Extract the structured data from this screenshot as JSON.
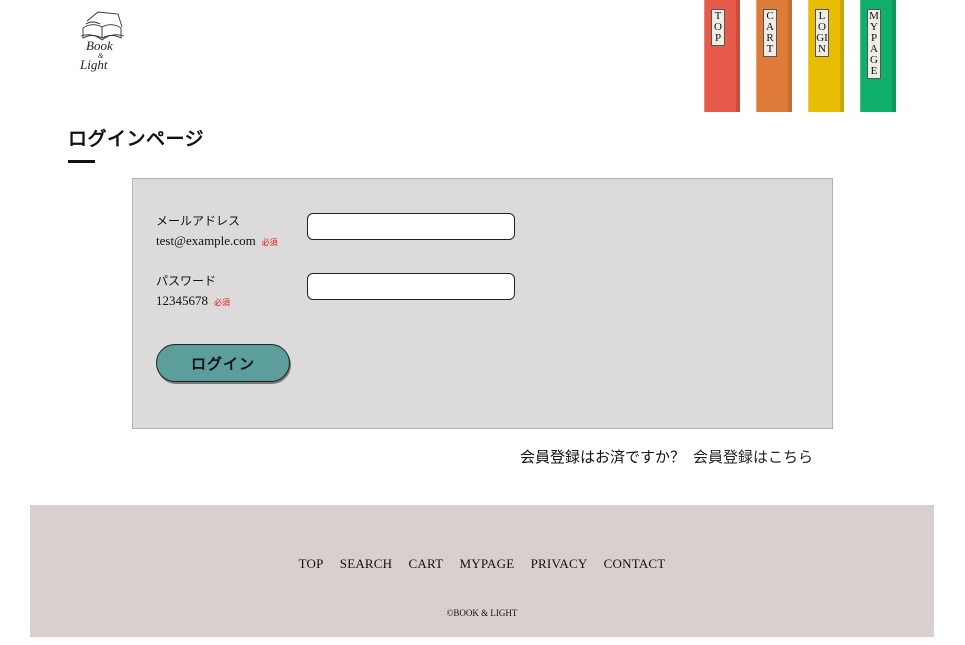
{
  "logo": {
    "line1": "Book",
    "line2": "&",
    "line3": "Light"
  },
  "nav": {
    "top": "TOP",
    "cart": "CART",
    "login": "LOGIN",
    "mypage": "MYPAGE",
    "colors": {
      "top": "#e85b4b",
      "cart": "#e07c39",
      "login": "#e8bd06",
      "mypage": "#0fae6a"
    }
  },
  "page": {
    "title": "ログインページ"
  },
  "form": {
    "email_label": "メールアドレス",
    "email_example": "test@example.com",
    "password_label": "パスワード",
    "password_example": "12345678",
    "required": "必須",
    "email_value": "",
    "password_value": "",
    "login_button": "ログイン",
    "button_color": "#5c9e9c"
  },
  "register": {
    "question": "会員登録はお済ですか？",
    "link": "会員登録はこちら"
  },
  "footer": {
    "links": [
      "TOP",
      "SEARCH",
      "CART",
      "MYPAGE",
      "PRIVACY",
      "CONTACT"
    ],
    "copyright": "©BOOK & LIGHT"
  }
}
